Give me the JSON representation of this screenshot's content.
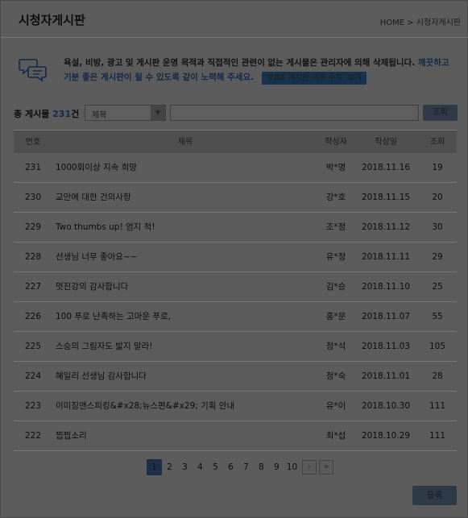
{
  "header": {
    "title": "시청자게시판",
    "breadcrumb": "HOME > 시청자게시판"
  },
  "notice": {
    "line1_a": "욕설, 비방, 광고 및 게시판 운영 목적과 직접적인 관련이 없는 게시물은 관리자에 의해 삭제됩니다. ",
    "line1_b": "깨끗하고",
    "line2_a": "기분 좋은 게시판이 될 수 있도록 같이 노력해 주세요.",
    "button": "'EBS 게시판 이용 수칙' 보기"
  },
  "search": {
    "total_prefix": "총 게시물 ",
    "total_count": "231",
    "total_suffix": "건",
    "select_value": "제목",
    "button": "조회"
  },
  "table": {
    "headers": [
      "번호",
      "제목",
      "작성자",
      "작성일",
      "조회"
    ],
    "rows": [
      {
        "num": "231",
        "title": "1000회이상 지속 희망",
        "author": "박*명",
        "date": "2018.11.16",
        "views": "19"
      },
      {
        "num": "230",
        "title": "교안에 대한 건의사항",
        "author": "강*호",
        "date": "2018.11.15",
        "views": "20"
      },
      {
        "num": "229",
        "title": "Two thumbs up! 엄지 척!",
        "author": "조*정",
        "date": "2018.11.12",
        "views": "30"
      },
      {
        "num": "228",
        "title": "선생님 너무 좋아요~~",
        "author": "유*정",
        "date": "2018.11.11",
        "views": "29"
      },
      {
        "num": "227",
        "title": "멋진강의 감사합니다",
        "author": "김*승",
        "date": "2018.11.10",
        "views": "25"
      },
      {
        "num": "226",
        "title": "100 푸로 난족하는 고마운 푸로,",
        "author": "홍*문",
        "date": "2018.11.07",
        "views": "55"
      },
      {
        "num": "225",
        "title": "스승의 그림자도 밟지 말라!",
        "author": "정*석",
        "date": "2018.11.03",
        "views": "105"
      },
      {
        "num": "224",
        "title": "혜일리 선생님 감사합니다",
        "author": "정*숙",
        "date": "2018.11.01",
        "views": "28"
      },
      {
        "num": "223",
        "title": "이미징앤스피킹&#x28;뉴스편&#x29; 기획 안내",
        "author": "유*이",
        "date": "2018.10.30",
        "views": "111"
      },
      {
        "num": "222",
        "title": "찝찝소리",
        "author": "최*섭",
        "date": "2018.10.29",
        "views": "111"
      }
    ]
  },
  "pagination": {
    "pages": [
      "1",
      "2",
      "3",
      "4",
      "5",
      "6",
      "7",
      "8",
      "9",
      "10"
    ],
    "current": "1",
    "next": "›",
    "last": "»"
  },
  "write_button": "등록",
  "colors": {
    "accent": "#1b2f46",
    "overlay": "#5c5c5c"
  }
}
